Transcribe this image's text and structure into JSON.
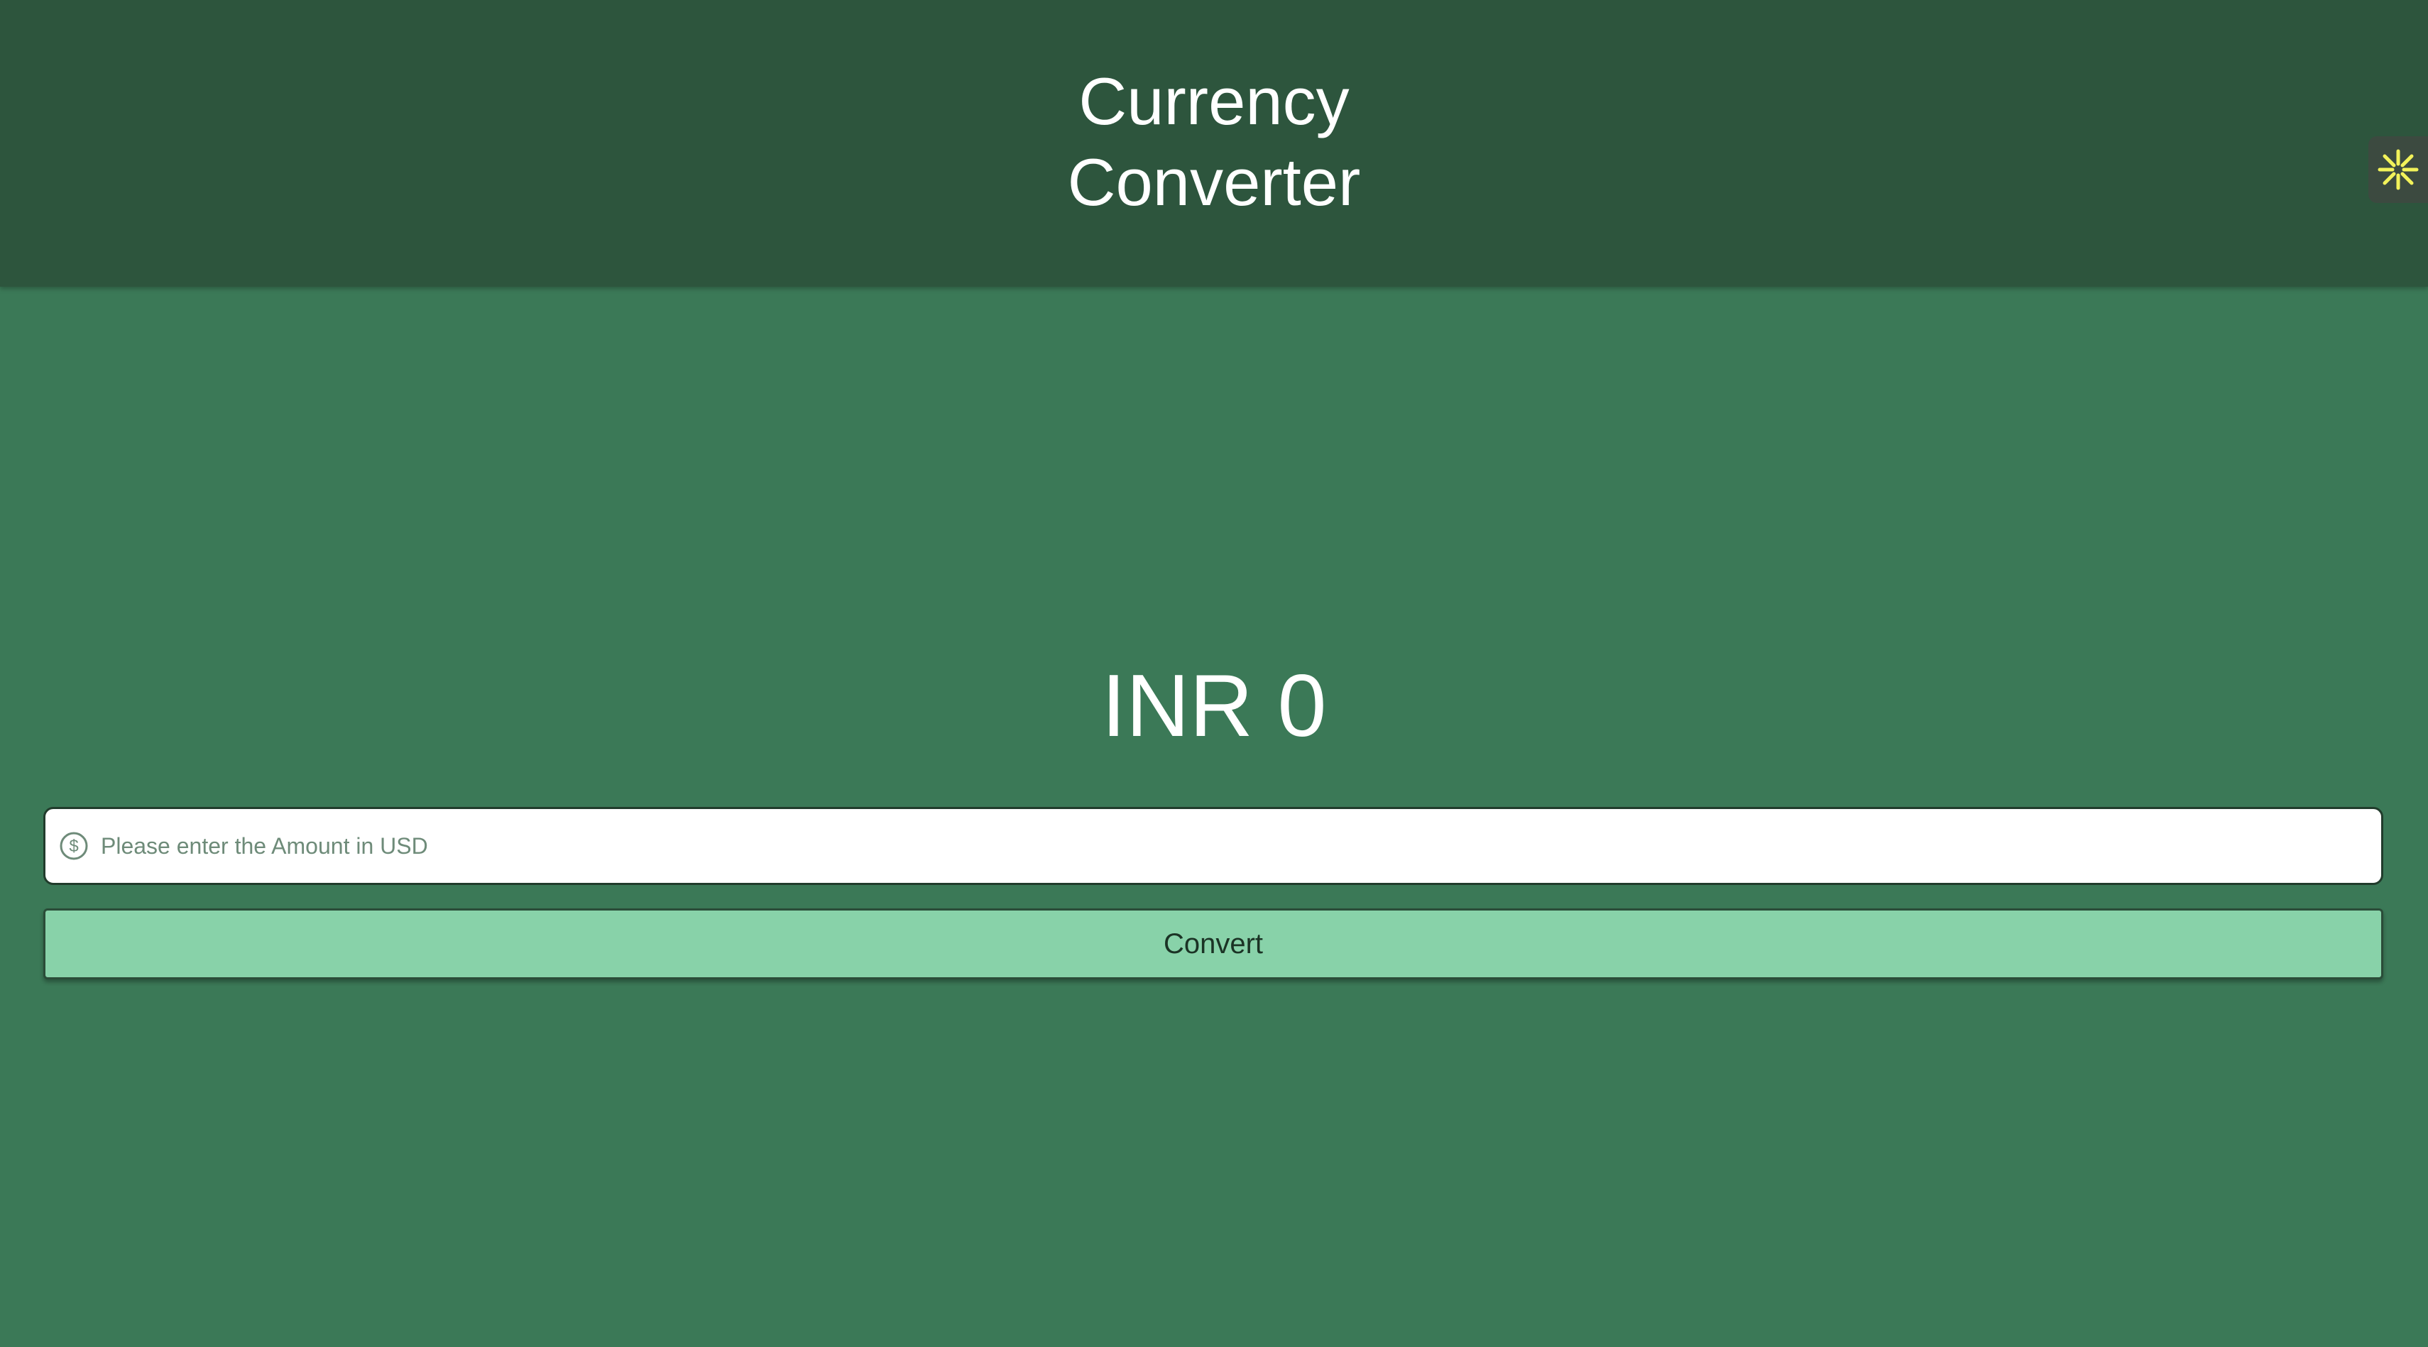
{
  "app": {
    "title": "Currency\nConverter"
  },
  "result": {
    "currency": "INR",
    "value": "0",
    "text": "INR 0"
  },
  "amount_input": {
    "placeholder": "Please enter the Amount in USD",
    "value": "",
    "icon": "dollar-circle-icon"
  },
  "convert_button": {
    "label": "Convert"
  },
  "side_tab": {
    "icon": "asterisk-burst-icon"
  },
  "colors": {
    "background": "#3b7957",
    "appbar": "#2d553d",
    "button": "#88d2a9",
    "accent_icon": "#f2f25a"
  }
}
